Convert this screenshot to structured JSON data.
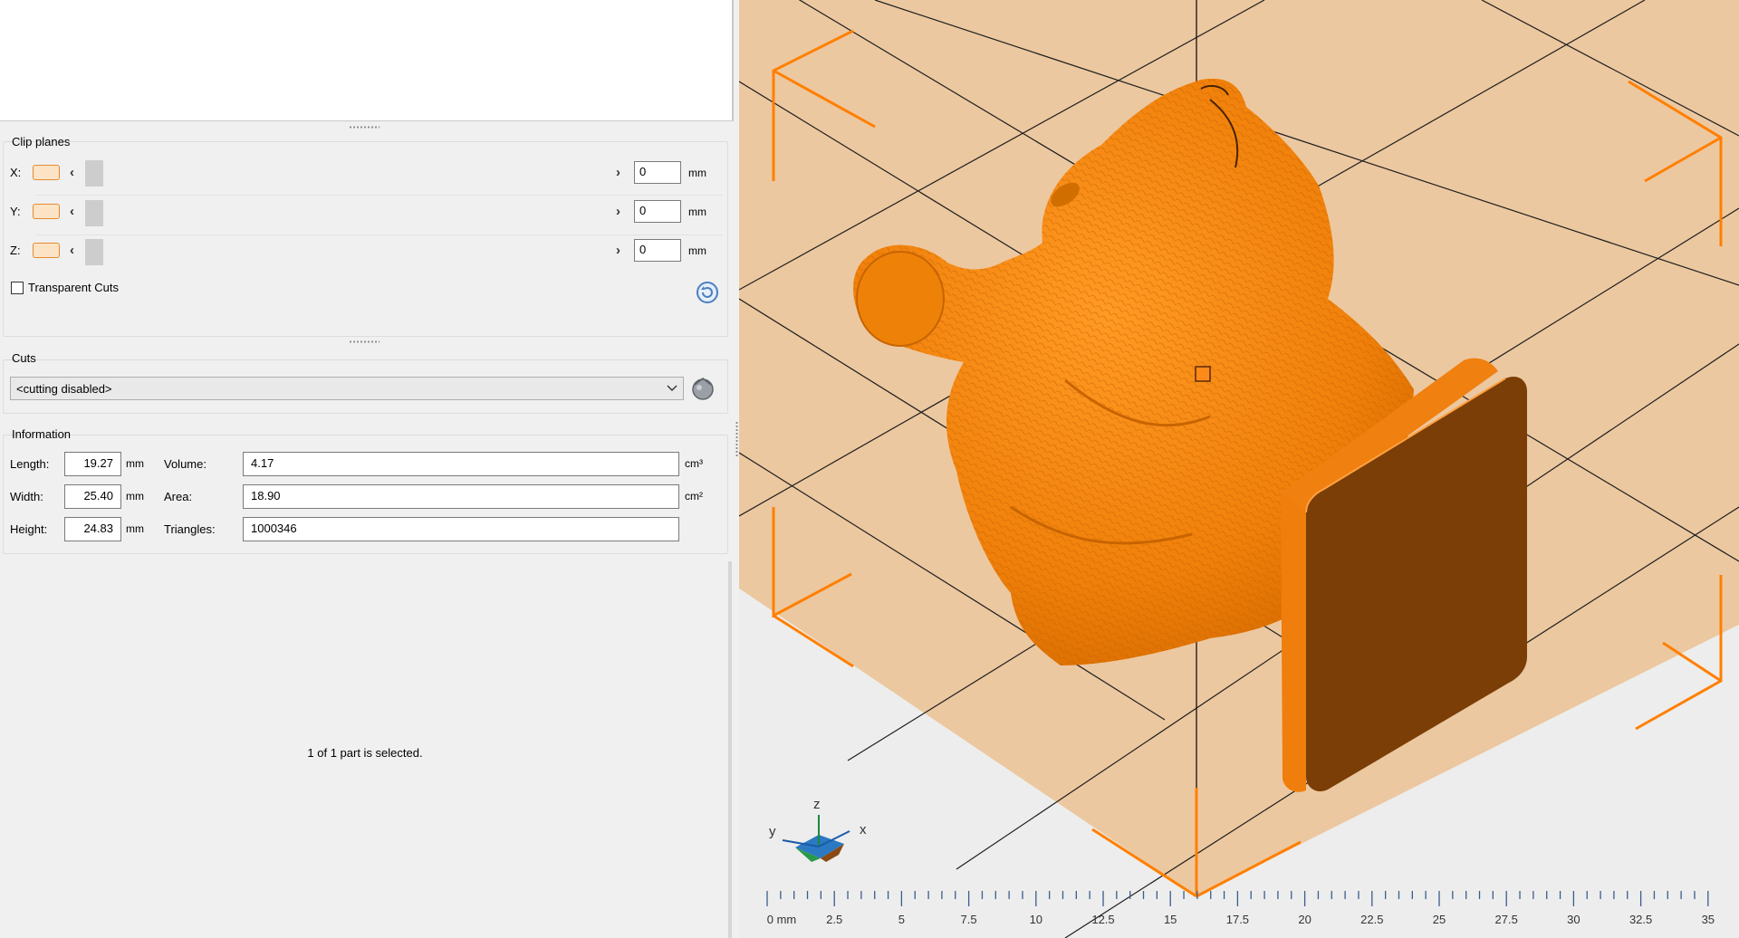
{
  "clip_planes": {
    "title": "Clip planes",
    "axes": [
      {
        "label": "X:",
        "value": "0",
        "unit": "mm"
      },
      {
        "label": "Y:",
        "value": "0",
        "unit": "mm"
      },
      {
        "label": "Z:",
        "value": "0",
        "unit": "mm"
      }
    ],
    "transparent_cuts_label": "Transparent Cuts",
    "transparent_cuts_checked": false,
    "chevron_left": "‹",
    "chevron_right": "›"
  },
  "cuts": {
    "title": "Cuts",
    "selected": "<cutting disabled>"
  },
  "information": {
    "title": "Information",
    "length_label": "Length:",
    "length": "19.27",
    "length_unit": "mm",
    "width_label": "Width:",
    "width": "25.40",
    "width_unit": "mm",
    "height_label": "Height:",
    "height": "24.83",
    "height_unit": "mm",
    "volume_label": "Volume:",
    "volume": "4.17",
    "volume_unit": "cm³",
    "area_label": "Area:",
    "area": "18.90",
    "area_unit": "cm²",
    "triangles_label": "Triangles:",
    "triangles": "1000346"
  },
  "status": "1 of 1 part is selected.",
  "viewport": {
    "axis_x": "x",
    "axis_y": "y",
    "axis_z": "z",
    "ruler": [
      "0 mm",
      "2.5",
      "5",
      "7.5",
      "10",
      "12.5",
      "15",
      "17.5",
      "20",
      "22.5",
      "25",
      "27.5",
      "30",
      "32.5",
      "35"
    ]
  },
  "colors": {
    "model": "#f28a12",
    "model_dark": "#7a3e06",
    "build_plate": "#ecc8a0",
    "bounding_box": "#ff7f00",
    "accent": "#4a7fc1"
  }
}
